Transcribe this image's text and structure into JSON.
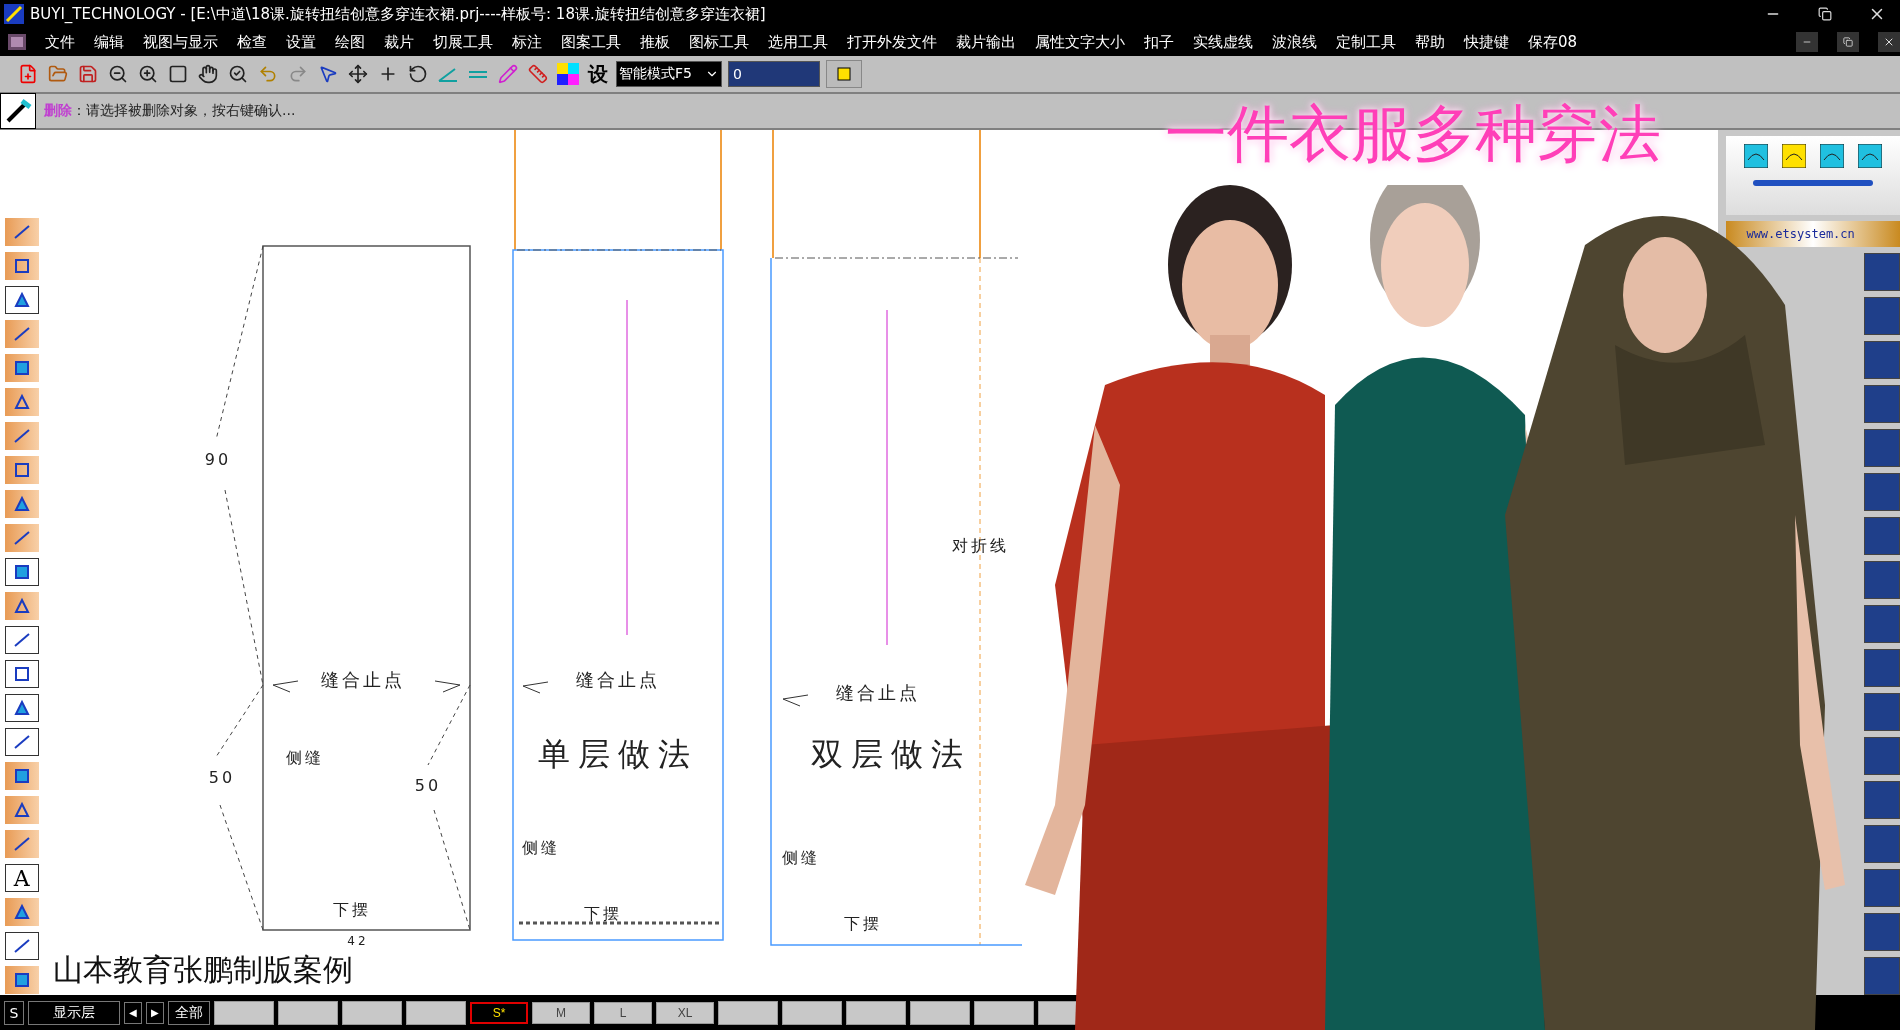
{
  "window": {
    "title": "BUYI_TECHNOLOGY - [E:\\中道\\18课.旋转扭结创意多穿连衣裙.prj----样板号: 18课.旋转扭结创意多穿连衣裙]"
  },
  "menu": [
    "文件",
    "编辑",
    "视图与显示",
    "检查",
    "设置",
    "绘图",
    "裁片",
    "切展工具",
    "标注",
    "图案工具",
    "推板",
    "图标工具",
    "选用工具",
    "打开外发文件",
    "裁片输出",
    "属性文字大小",
    "扣子",
    "实线虚线",
    "波浪线",
    "定制工具",
    "帮助",
    "快捷键",
    "保存08"
  ],
  "toolbar": {
    "text_button": "设",
    "mode": "智能模式F5",
    "value": "0"
  },
  "prompt": "**删除**：请选择被删除对象，按右键确认...",
  "heading": "一件衣服多种穿法",
  "left_tools": [
    {
      "kind": "icon",
      "framed": false
    },
    {
      "kind": "icon",
      "framed": false
    },
    {
      "kind": "icon",
      "framed": true
    },
    {
      "kind": "icon",
      "framed": false
    },
    {
      "kind": "icon",
      "framed": false
    },
    {
      "kind": "icon",
      "framed": false
    },
    {
      "kind": "icon",
      "framed": false
    },
    {
      "kind": "icon",
      "framed": false
    },
    {
      "kind": "icon",
      "framed": false
    },
    {
      "kind": "icon",
      "framed": false
    },
    {
      "kind": "icon",
      "framed": true
    },
    {
      "kind": "icon",
      "framed": false
    },
    {
      "kind": "icon",
      "framed": true
    },
    {
      "kind": "icon",
      "framed": true
    },
    {
      "kind": "icon",
      "framed": true
    },
    {
      "kind": "icon",
      "framed": true
    },
    {
      "kind": "icon",
      "framed": false
    },
    {
      "kind": "icon",
      "framed": false
    },
    {
      "kind": "icon",
      "framed": false
    },
    {
      "kind": "text",
      "framed": true,
      "label": "A"
    },
    {
      "kind": "icon",
      "framed": false
    },
    {
      "kind": "icon",
      "framed": true
    },
    {
      "kind": "icon",
      "framed": false
    }
  ],
  "pieces": [
    {
      "texts": [
        "90",
        "50",
        "50",
        "42",
        "缝合止点",
        "侧缝",
        "下摆"
      ]
    },
    {
      "texts": [
        "缝合止点",
        "单层做法",
        "侧缝",
        "下摆"
      ]
    },
    {
      "texts": [
        "缝合止点",
        "双层做法",
        "侧缝",
        "下摆",
        "对折线"
      ]
    }
  ],
  "caption": "山本教育张鹏制版案例",
  "right_panel": {
    "url": "www.etsystem.cn"
  },
  "status_bar": {
    "layer_key": "S",
    "layer": "显示层",
    "prev": "◀",
    "next": "▶",
    "all": "全部",
    "sizes": [
      {
        "label": "S*",
        "selected": true
      },
      {
        "label": "M",
        "selected": false
      },
      {
        "label": "L",
        "selected": false
      },
      {
        "label": "XL",
        "selected": false
      }
    ]
  }
}
